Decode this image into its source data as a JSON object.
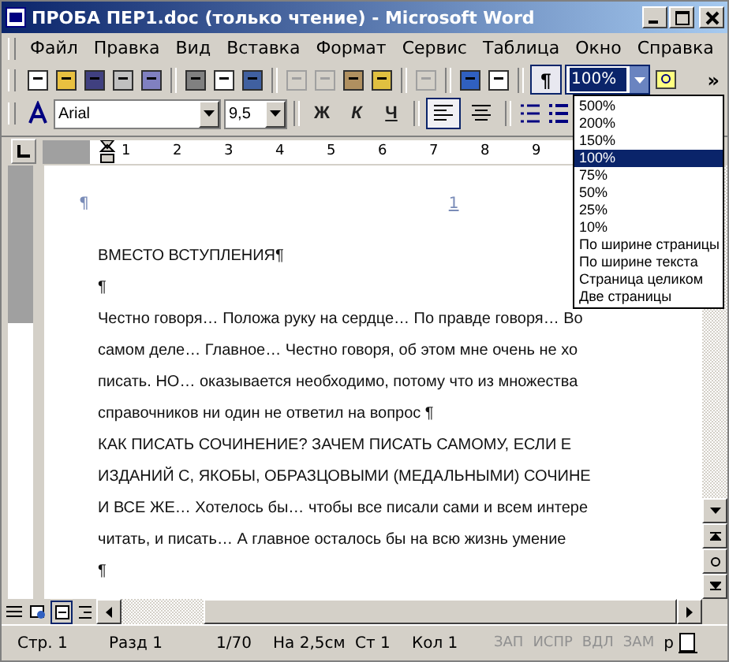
{
  "window": {
    "title": "ПРОБА ПЕР1.doc (только чтение) - Microsoft Word"
  },
  "menu": [
    "Файл",
    "Правка",
    "Вид",
    "Вставка",
    "Формат",
    "Сервис",
    "Таблица",
    "Окно",
    "Справка"
  ],
  "toolbar": {
    "show_marks": true,
    "zoom_value": "100%",
    "overflow": "»"
  },
  "zoom_menu": [
    {
      "label": "500%",
      "selected": false
    },
    {
      "label": "200%",
      "selected": false
    },
    {
      "label": "150%",
      "selected": false
    },
    {
      "label": "100%",
      "selected": true
    },
    {
      "label": "75%",
      "selected": false
    },
    {
      "label": "50%",
      "selected": false
    },
    {
      "label": "25%",
      "selected": false
    },
    {
      "label": "10%",
      "selected": false
    },
    {
      "label": "По ширине страницы",
      "selected": false
    },
    {
      "label": "По ширине текста",
      "selected": false
    },
    {
      "label": "Страница целиком",
      "selected": false
    },
    {
      "label": "Две страницы",
      "selected": false
    }
  ],
  "formatting": {
    "font": "Arial",
    "size": "9,5",
    "styles": [
      "Ж",
      "К",
      "Ч"
    ],
    "align": [
      {
        "selected": true
      },
      {
        "selected": false
      }
    ]
  },
  "ruler": [
    "1",
    "2",
    "3",
    "4",
    "5",
    "6",
    "7",
    "8",
    "9"
  ],
  "header": {
    "mark": "¶",
    "page_number": "1"
  },
  "document": [
    "ВМЕСТО ВСТУПЛЕНИЯ¶",
    "¶",
    "Честно говоря… Положа руку на сердце… По правде говоря… Во",
    "самом деле… Главное… Честно говоря, об этом мне очень не хо",
    "писать. НО… оказывается необходимо, потому что из множества",
    "справочников ни один не ответил на вопрос ¶",
    "КАК ПИСАТЬ СОЧИНЕНИЕ? ЗАЧЕМ ПИСАТЬ САМОМУ, ЕСЛИ Е",
    "ИЗДАНИЙ С, ЯКОБЫ, ОБРАЗЦОВЫМИ (МЕДАЛЬНЫМИ) СОЧИНЕ",
    "И ВСЕ ЖЕ… Хотелось бы… чтобы все писали сами и всем интере",
    "читать, и писать… А главное осталось бы на всю жизнь умение",
    "¶"
  ],
  "status_bar": {
    "fields": [
      "Стр. 1",
      "Разд 1",
      "1/70",
      "На 2,5см",
      "Ст 1",
      "Кол 1"
    ],
    "indicators": [
      {
        "label": "ЗАП",
        "on": false
      },
      {
        "label": "ИСПР",
        "on": false
      },
      {
        "label": "ВДЛ",
        "on": false
      },
      {
        "label": "ЗАМ",
        "on": false
      }
    ],
    "language": "р"
  }
}
